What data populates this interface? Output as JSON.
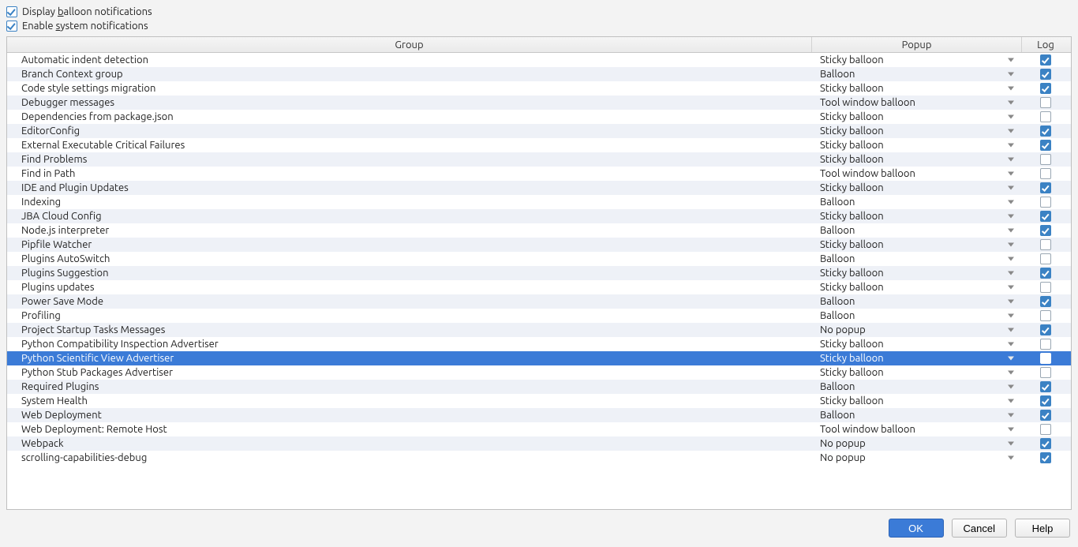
{
  "top": {
    "display_balloon_prefix": "Display ",
    "display_balloon_u": "b",
    "display_balloon_suffix": "alloon notifications",
    "enable_system_prefix": "Enable ",
    "enable_system_u": "s",
    "enable_system_suffix": "ystem notifications"
  },
  "headers": {
    "group": "Group",
    "popup": "Popup",
    "log": "Log"
  },
  "rows": [
    {
      "group": "Automatic indent detection",
      "popup": "Sticky balloon",
      "log": true,
      "selected": false
    },
    {
      "group": "Branch Context group",
      "popup": "Balloon",
      "log": true,
      "selected": false
    },
    {
      "group": "Code style settings migration",
      "popup": "Sticky balloon",
      "log": true,
      "selected": false
    },
    {
      "group": "Debugger messages",
      "popup": "Tool window balloon",
      "log": false,
      "selected": false
    },
    {
      "group": "Dependencies from package.json",
      "popup": "Sticky balloon",
      "log": false,
      "selected": false
    },
    {
      "group": "EditorConfig",
      "popup": "Sticky balloon",
      "log": true,
      "selected": false
    },
    {
      "group": "External Executable Critical Failures",
      "popup": "Sticky balloon",
      "log": true,
      "selected": false
    },
    {
      "group": "Find Problems",
      "popup": "Sticky balloon",
      "log": false,
      "selected": false
    },
    {
      "group": "Find in Path",
      "popup": "Tool window balloon",
      "log": false,
      "selected": false
    },
    {
      "group": "IDE and Plugin Updates",
      "popup": "Sticky balloon",
      "log": true,
      "selected": false
    },
    {
      "group": "Indexing",
      "popup": "Balloon",
      "log": false,
      "selected": false
    },
    {
      "group": "JBA Cloud Config",
      "popup": "Sticky balloon",
      "log": true,
      "selected": false
    },
    {
      "group": "Node.js interpreter",
      "popup": "Balloon",
      "log": true,
      "selected": false
    },
    {
      "group": "Pipfile Watcher",
      "popup": "Sticky balloon",
      "log": false,
      "selected": false
    },
    {
      "group": "Plugins AutoSwitch",
      "popup": "Balloon",
      "log": false,
      "selected": false
    },
    {
      "group": "Plugins Suggestion",
      "popup": "Sticky balloon",
      "log": true,
      "selected": false
    },
    {
      "group": "Plugins updates",
      "popup": "Sticky balloon",
      "log": false,
      "selected": false
    },
    {
      "group": "Power Save Mode",
      "popup": "Balloon",
      "log": true,
      "selected": false
    },
    {
      "group": "Profiling",
      "popup": "Balloon",
      "log": false,
      "selected": false
    },
    {
      "group": "Project Startup Tasks Messages",
      "popup": "No popup",
      "log": true,
      "selected": false
    },
    {
      "group": "Python Compatibility Inspection Advertiser",
      "popup": "Sticky balloon",
      "log": false,
      "selected": false
    },
    {
      "group": "Python Scientific View Advertiser",
      "popup": "Sticky balloon",
      "log": false,
      "selected": true
    },
    {
      "group": "Python Stub Packages Advertiser",
      "popup": "Sticky balloon",
      "log": false,
      "selected": false
    },
    {
      "group": "Required Plugins",
      "popup": "Balloon",
      "log": true,
      "selected": false
    },
    {
      "group": "System Health",
      "popup": "Sticky balloon",
      "log": true,
      "selected": false
    },
    {
      "group": "Web Deployment",
      "popup": "Balloon",
      "log": true,
      "selected": false
    },
    {
      "group": "Web Deployment: Remote Host",
      "popup": "Tool window balloon",
      "log": false,
      "selected": false
    },
    {
      "group": "Webpack",
      "popup": "No popup",
      "log": true,
      "selected": false
    },
    {
      "group": "scrolling-capabilities-debug",
      "popup": "No popup",
      "log": true,
      "selected": false
    }
  ],
  "buttons": {
    "ok": "OK",
    "cancel": "Cancel",
    "help": "Help"
  }
}
